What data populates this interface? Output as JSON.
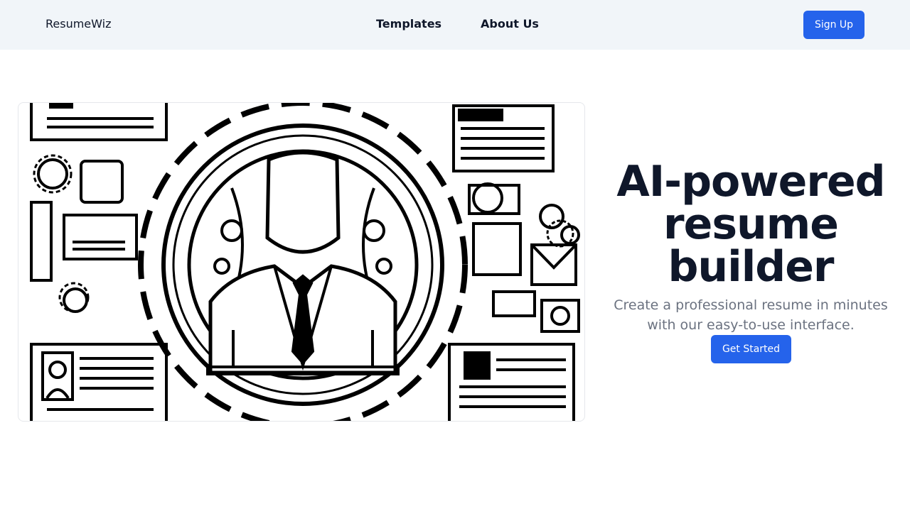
{
  "header": {
    "brand": "ResumeWiz",
    "nav": [
      {
        "label": "Templates"
      },
      {
        "label": "About Us"
      }
    ],
    "signup_label": "Sign Up"
  },
  "hero": {
    "headline": "AI-powered resume builder",
    "subtitle": "Create a professional resume in minutes with our easy-to-use interface.",
    "cta_label": "Get Started",
    "image_icon": "businessman-gear-illustration"
  },
  "colors": {
    "accent": "#2563eb",
    "header_bg": "#f1f5f9",
    "text": "#0f172a",
    "muted": "#6b7280"
  }
}
